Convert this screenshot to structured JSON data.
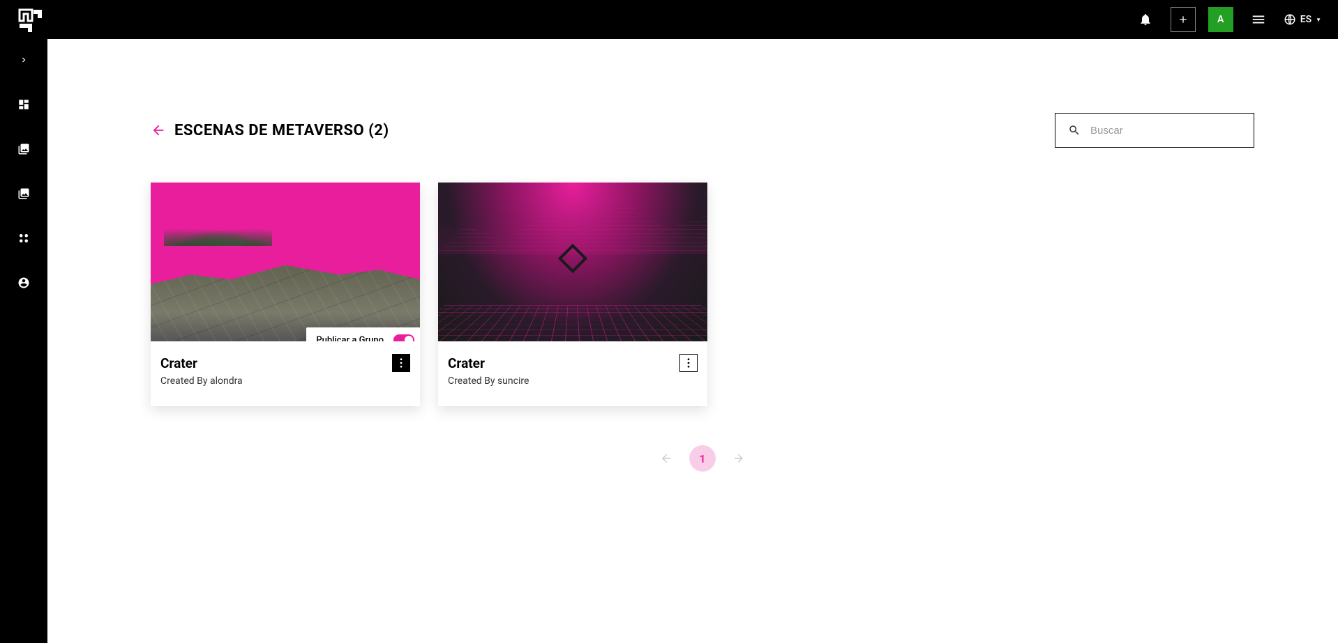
{
  "header": {
    "avatar_letter": "A",
    "lang_label": "ES"
  },
  "page": {
    "title": "ESCENAS DE METAVERSO (2)"
  },
  "search": {
    "placeholder": "Buscar"
  },
  "popover": {
    "label": "Publicar a Grupo"
  },
  "cards": [
    {
      "title": "Crater",
      "created_by": "Created By alondra"
    },
    {
      "title": "Crater",
      "created_by": "Created By suncire"
    }
  ],
  "pagination": {
    "current": "1"
  }
}
